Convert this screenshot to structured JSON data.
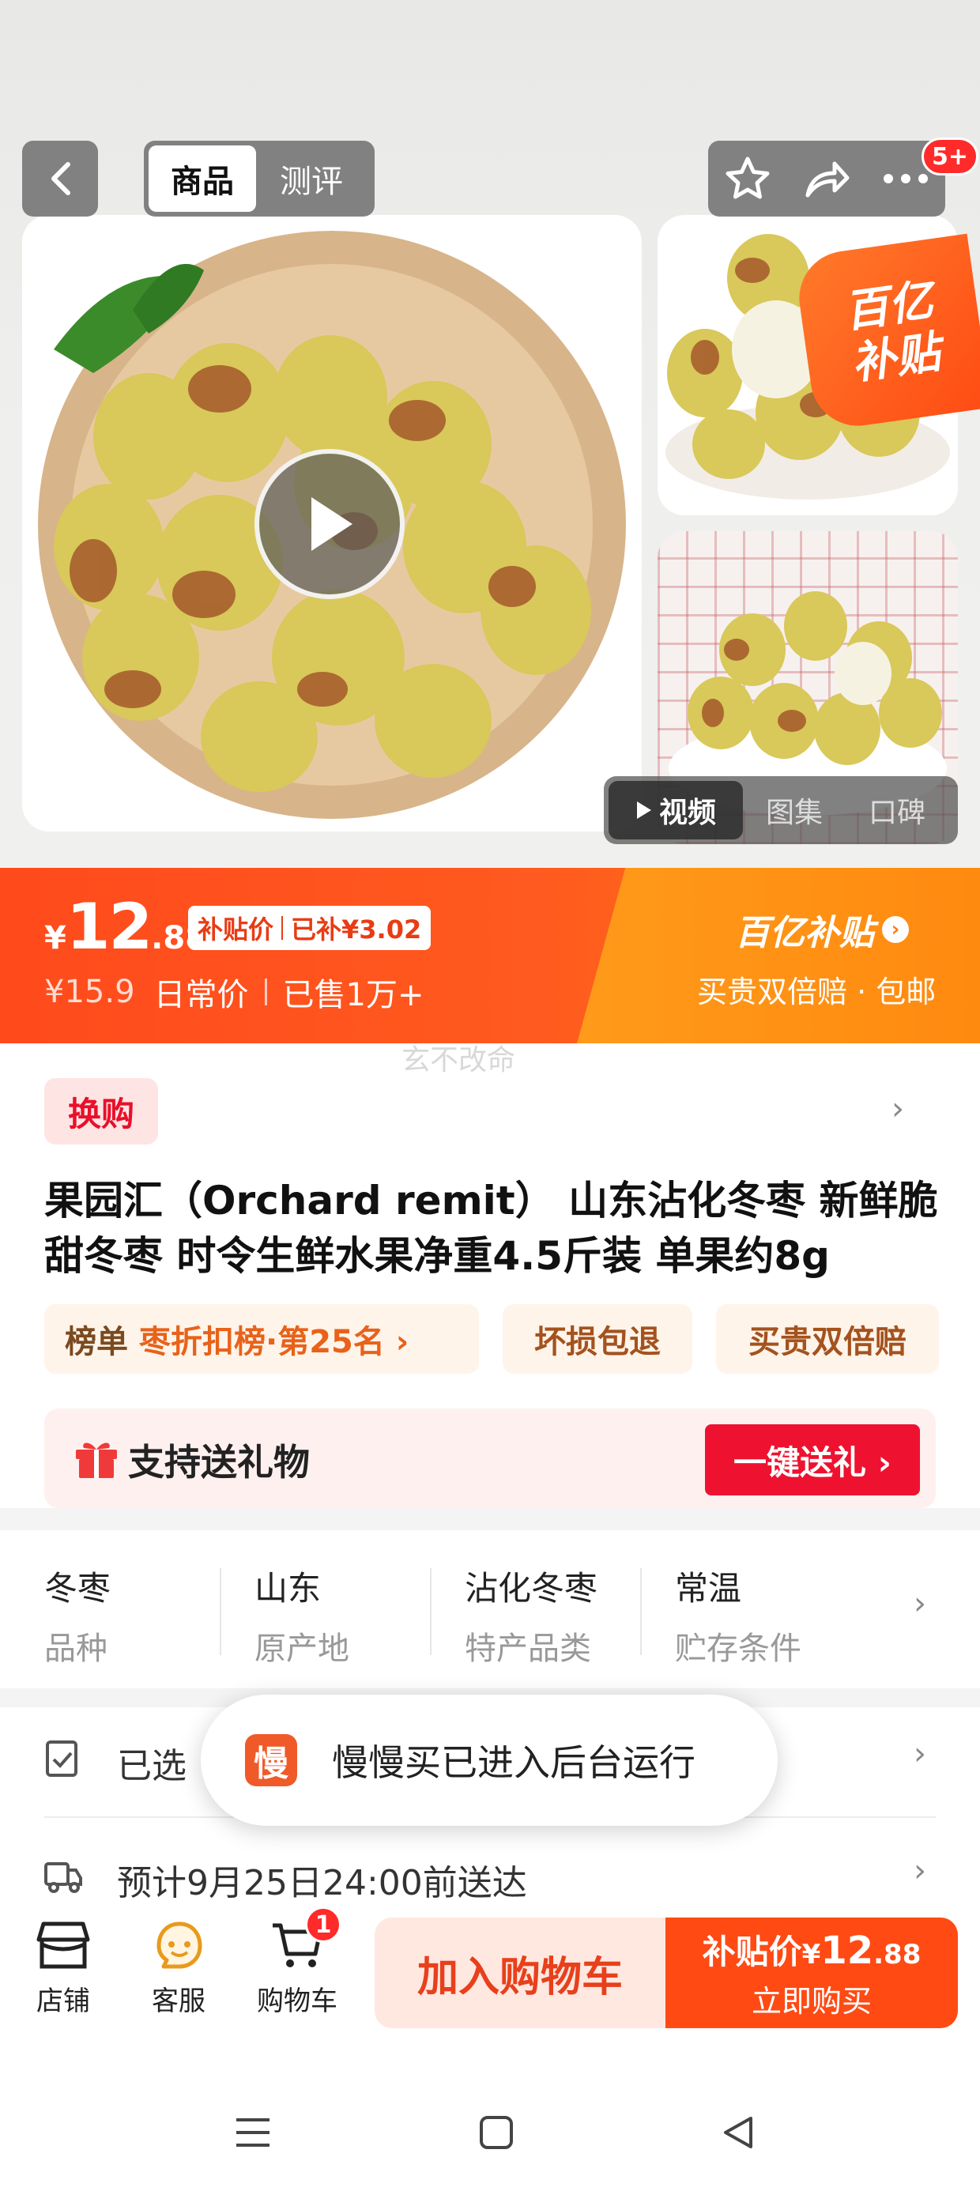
{
  "header": {
    "tabs": [
      {
        "label": "商品",
        "active": true
      },
      {
        "label": "测评",
        "active": false
      }
    ],
    "more_badge": "5+"
  },
  "gallery": {
    "subsidy_tag_line1": "百亿",
    "subsidy_tag_line2": "补贴",
    "media_tabs": [
      {
        "label": "视频",
        "active": true
      },
      {
        "label": "图集",
        "active": false
      },
      {
        "label": "口碑",
        "active": false
      }
    ]
  },
  "price": {
    "currency": "¥",
    "integer": "12",
    "decimal": ".88",
    "badge_left": "补贴价",
    "badge_right": "已补¥3.02",
    "original_price": "¥15.9",
    "original_label": "日常价",
    "sold": "已售1万+",
    "promo_title": "百亿补贴",
    "promo_desc": "买贵双倍赔 · 包邮",
    "accent_color": "#ff4a1c"
  },
  "watermark": "玄不改命",
  "product": {
    "swap_tag": "换购",
    "title": "果园汇（Orchard remit） 山东沾化冬枣 新鲜脆甜冬枣 时令生鲜水果净重4.5斤装 单果约8g",
    "pills": [
      {
        "label": "榜单",
        "highlight": "枣折扣榜·第25名 ›"
      },
      {
        "label": "坏损包退",
        "highlight": ""
      },
      {
        "label": "买贵双倍赔",
        "highlight": ""
      }
    ]
  },
  "gift": {
    "text": "支持送礼物",
    "button": "一键送礼 ›"
  },
  "attributes": [
    {
      "value": "冬枣",
      "key": "品种"
    },
    {
      "value": "山东",
      "key": "原产地"
    },
    {
      "value": "沾化冬枣",
      "key": "特产品类"
    },
    {
      "value": "常温",
      "key": "贮存条件"
    }
  ],
  "selection": {
    "text": "已选"
  },
  "delivery": {
    "text": "预计9月25日24:00前送达"
  },
  "toast": {
    "icon_char": "慢",
    "text": "慢慢买已进入后台运行"
  },
  "actionbar": {
    "store": "店铺",
    "service": "客服",
    "cart": "购物车",
    "cart_count": "1",
    "add_to_cart": "加入购物车",
    "buy_label": "补贴价",
    "buy_currency": "¥",
    "buy_integer": "12",
    "buy_decimal": ".88",
    "buy_now": "立即购买"
  }
}
